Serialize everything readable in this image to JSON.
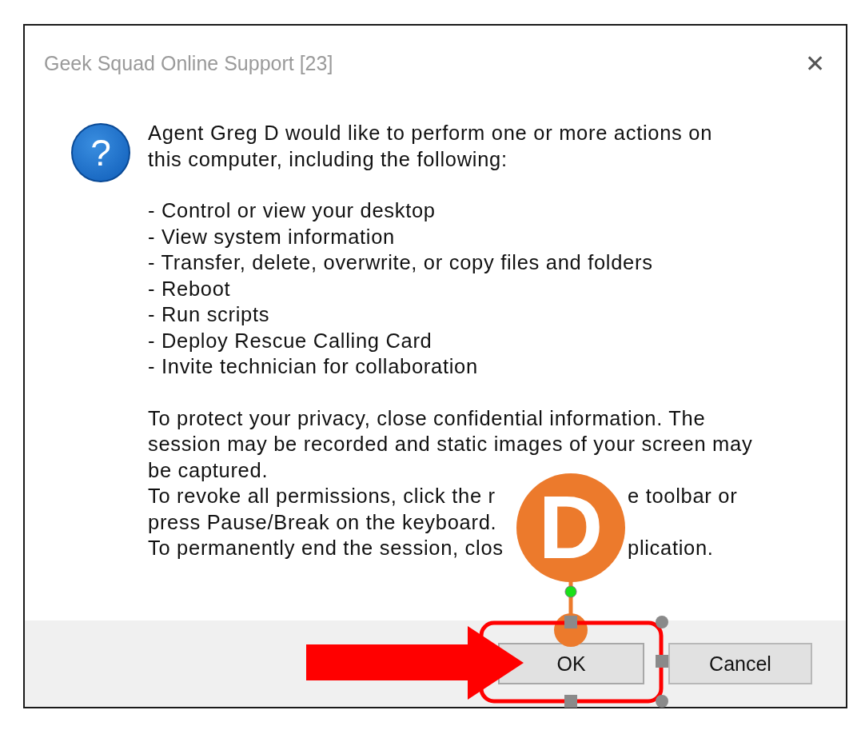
{
  "window": {
    "title": "Geek Squad Online Support [23]",
    "close_glyph": "✕"
  },
  "message": {
    "icon_glyph": "?",
    "intro_lines": [
      "Agent Greg D would like to perform one or more actions on",
      "this computer, including the following:"
    ],
    "actions": [
      "- Control or view your desktop",
      "- View system information",
      "- Transfer, delete, overwrite, or copy files and folders",
      "- Reboot",
      "- Run scripts",
      "- Deploy Rescue Calling Card",
      "- Invite technician for collaboration"
    ],
    "privacy_lines": [
      "To protect your privacy, close confidential information. The",
      "session may be recorded and static images of your screen may",
      "be captured."
    ],
    "notice_lines": [
      {
        "before": "To revoke all permissions, click the r",
        "after": "e toolbar or"
      },
      {
        "before": "press Pause/Break on the keyboard."
      },
      {
        "before": "To permanently end the session, clos",
        "after": "plication."
      }
    ]
  },
  "buttons": [
    {
      "label": "OK",
      "highlighted": true
    },
    {
      "label": "Cancel",
      "highlighted": false
    }
  ],
  "annotation": {
    "marker_label": "D"
  }
}
